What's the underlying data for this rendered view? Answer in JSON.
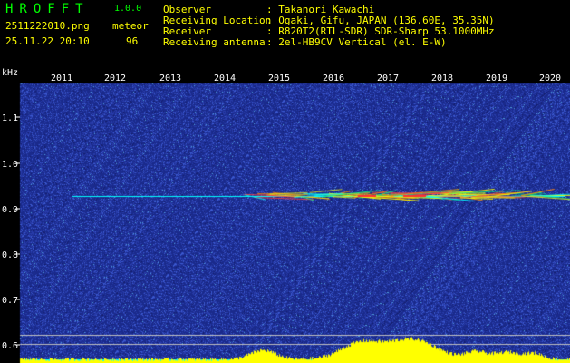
{
  "app": {
    "name": "HROFFT",
    "version": "1.0.0",
    "filename": "2511222010.png",
    "datetime": "25.11.22 20:10"
  },
  "meteor": {
    "label": "meteor",
    "count": "96"
  },
  "info": [
    {
      "label": "Observer",
      "value": ": Takanori Kawachi"
    },
    {
      "label": "Receiving Location",
      "value": ": Ogaki, Gifu, JAPAN (136.60E, 35.35N)"
    },
    {
      "label": "Receiver",
      "value": ": R820T2(RTL-SDR) SDR-Sharp 53.1000MHz"
    },
    {
      "label": "Receiving antenna",
      "value": ": 2el-HB9CV Vertical (el. E-W)"
    }
  ],
  "colors": {
    "background": "#000000",
    "spectrum_bg": "#1a2a8c",
    "signal": "#00ffff",
    "peaks": "#ffff00",
    "header_text": "#ffffff",
    "title_text": "#00ff00",
    "meta_text": "#ffff00"
  },
  "chart_data": {
    "type": "heatmap",
    "ylabel": "kHz",
    "y_ticks": [
      "1.1",
      "1.0",
      "0.9",
      "0.8",
      "0.7",
      "0.6"
    ],
    "x_ticks": [
      "2011",
      "2012",
      "2013",
      "2014",
      "2015",
      "2016",
      "2017",
      "2018",
      "2019",
      "2020"
    ],
    "carrier_khz": 0.925
  }
}
